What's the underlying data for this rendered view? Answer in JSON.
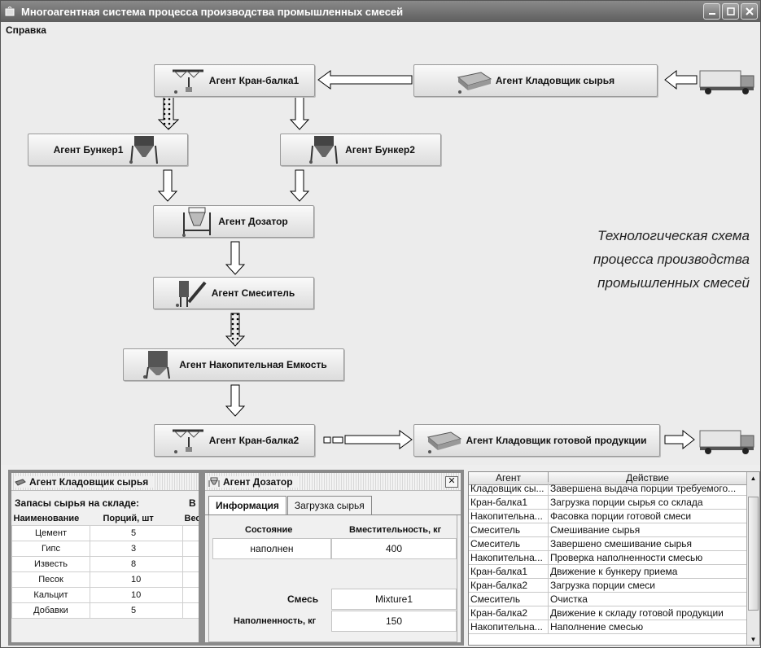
{
  "window": {
    "title": "Многоагентная система процесса производства промышленных смесей"
  },
  "menu": {
    "help": "Справка"
  },
  "agents": {
    "crane1": "Агент Кран-балка1",
    "raw_store": "Агент Кладовщик сырья",
    "bunker1": "Агент Бункер1",
    "bunker2": "Агент Бункер2",
    "doser": "Агент Дозатор",
    "mixer": "Агент Смеситель",
    "tank": "Агент Накопительная Емкость",
    "crane2": "Агент Кран-балка2",
    "product_store": "Агент Кладовщик готовой продукции"
  },
  "caption": [
    "Технологическая схема",
    "процесса производства",
    "промышленных смесей"
  ],
  "raw_panel": {
    "title": "Агент Кладовщик сырья",
    "stock_label": "Запасы сырья на складе:",
    "stock_label_cut": "В",
    "columns": [
      "Наименование",
      "Порций, шт",
      "Вес"
    ],
    "rows": [
      [
        "Цемент",
        "5",
        ""
      ],
      [
        "Гипс",
        "3",
        ""
      ],
      [
        "Известь",
        "8",
        ""
      ],
      [
        "Песок",
        "10",
        ""
      ],
      [
        "Кальцит",
        "10",
        ""
      ],
      [
        "Добавки",
        "5",
        ""
      ]
    ]
  },
  "doser_panel": {
    "title": "Агент Дозатор",
    "tabs": [
      "Информация",
      "Загрузка сырья"
    ],
    "state_label": "Состояние",
    "capacity_label": "Вместительность, кг",
    "state_value": "наполнен",
    "capacity_value": "400",
    "mix_label": "Смесь",
    "mix_value": "Mixture1",
    "fill_label": "Наполненность, кг",
    "fill_value": "150"
  },
  "log": {
    "columns": [
      "Агент",
      "Действие"
    ],
    "rows": [
      [
        "Кладовщик сы...",
        "Завершена выдача порции требуемого..."
      ],
      [
        "Кран-балка1",
        "Загрузка порции сырья со склада"
      ],
      [
        "Накопительна...",
        "Фасовка порции готовой смеси"
      ],
      [
        "Смеситель",
        "Смешивание сырья"
      ],
      [
        "Смеситель",
        "Завершено смешивание сырья"
      ],
      [
        "Накопительна...",
        "Проверка наполненности смесью"
      ],
      [
        "Кран-балка1",
        "Движение к бункеру приема"
      ],
      [
        "Кран-балка2",
        "Загрузка порции смеси"
      ],
      [
        "Смеситель",
        "Очистка"
      ],
      [
        "Кран-балка2",
        "Движение к складу готовой продукции"
      ],
      [
        "Накопительна...",
        "Наполнение смесью"
      ]
    ]
  }
}
